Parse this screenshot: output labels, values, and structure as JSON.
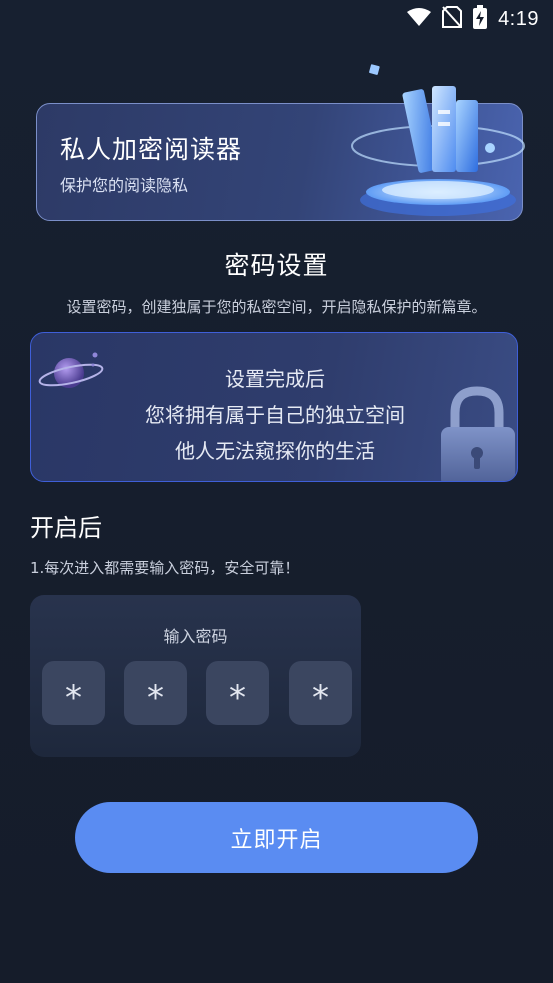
{
  "status_bar": {
    "time": "4:19"
  },
  "banner": {
    "title": "私人加密阅读器",
    "subtitle": "保护您的阅读隐私"
  },
  "section": {
    "title": "密码设置",
    "description": "设置密码，创建独属于您的私密空间，开启隐私保护的新篇章。"
  },
  "info_card": {
    "lines": [
      "设置完成后",
      "您将拥有属于自己的独立空间",
      "他人无法窥探你的生活"
    ]
  },
  "after": {
    "title": "开启后",
    "items": [
      "1.每次进入都需要输入密码，安全可靠！"
    ]
  },
  "password_panel": {
    "label": "输入密码",
    "digits": [
      "*",
      "*",
      "*",
      "*"
    ]
  },
  "start_button": {
    "label": "立即开启"
  },
  "colors": {
    "accent": "#5a8cf2",
    "background": "#161d2c",
    "card_border": "#3f5fd8"
  }
}
